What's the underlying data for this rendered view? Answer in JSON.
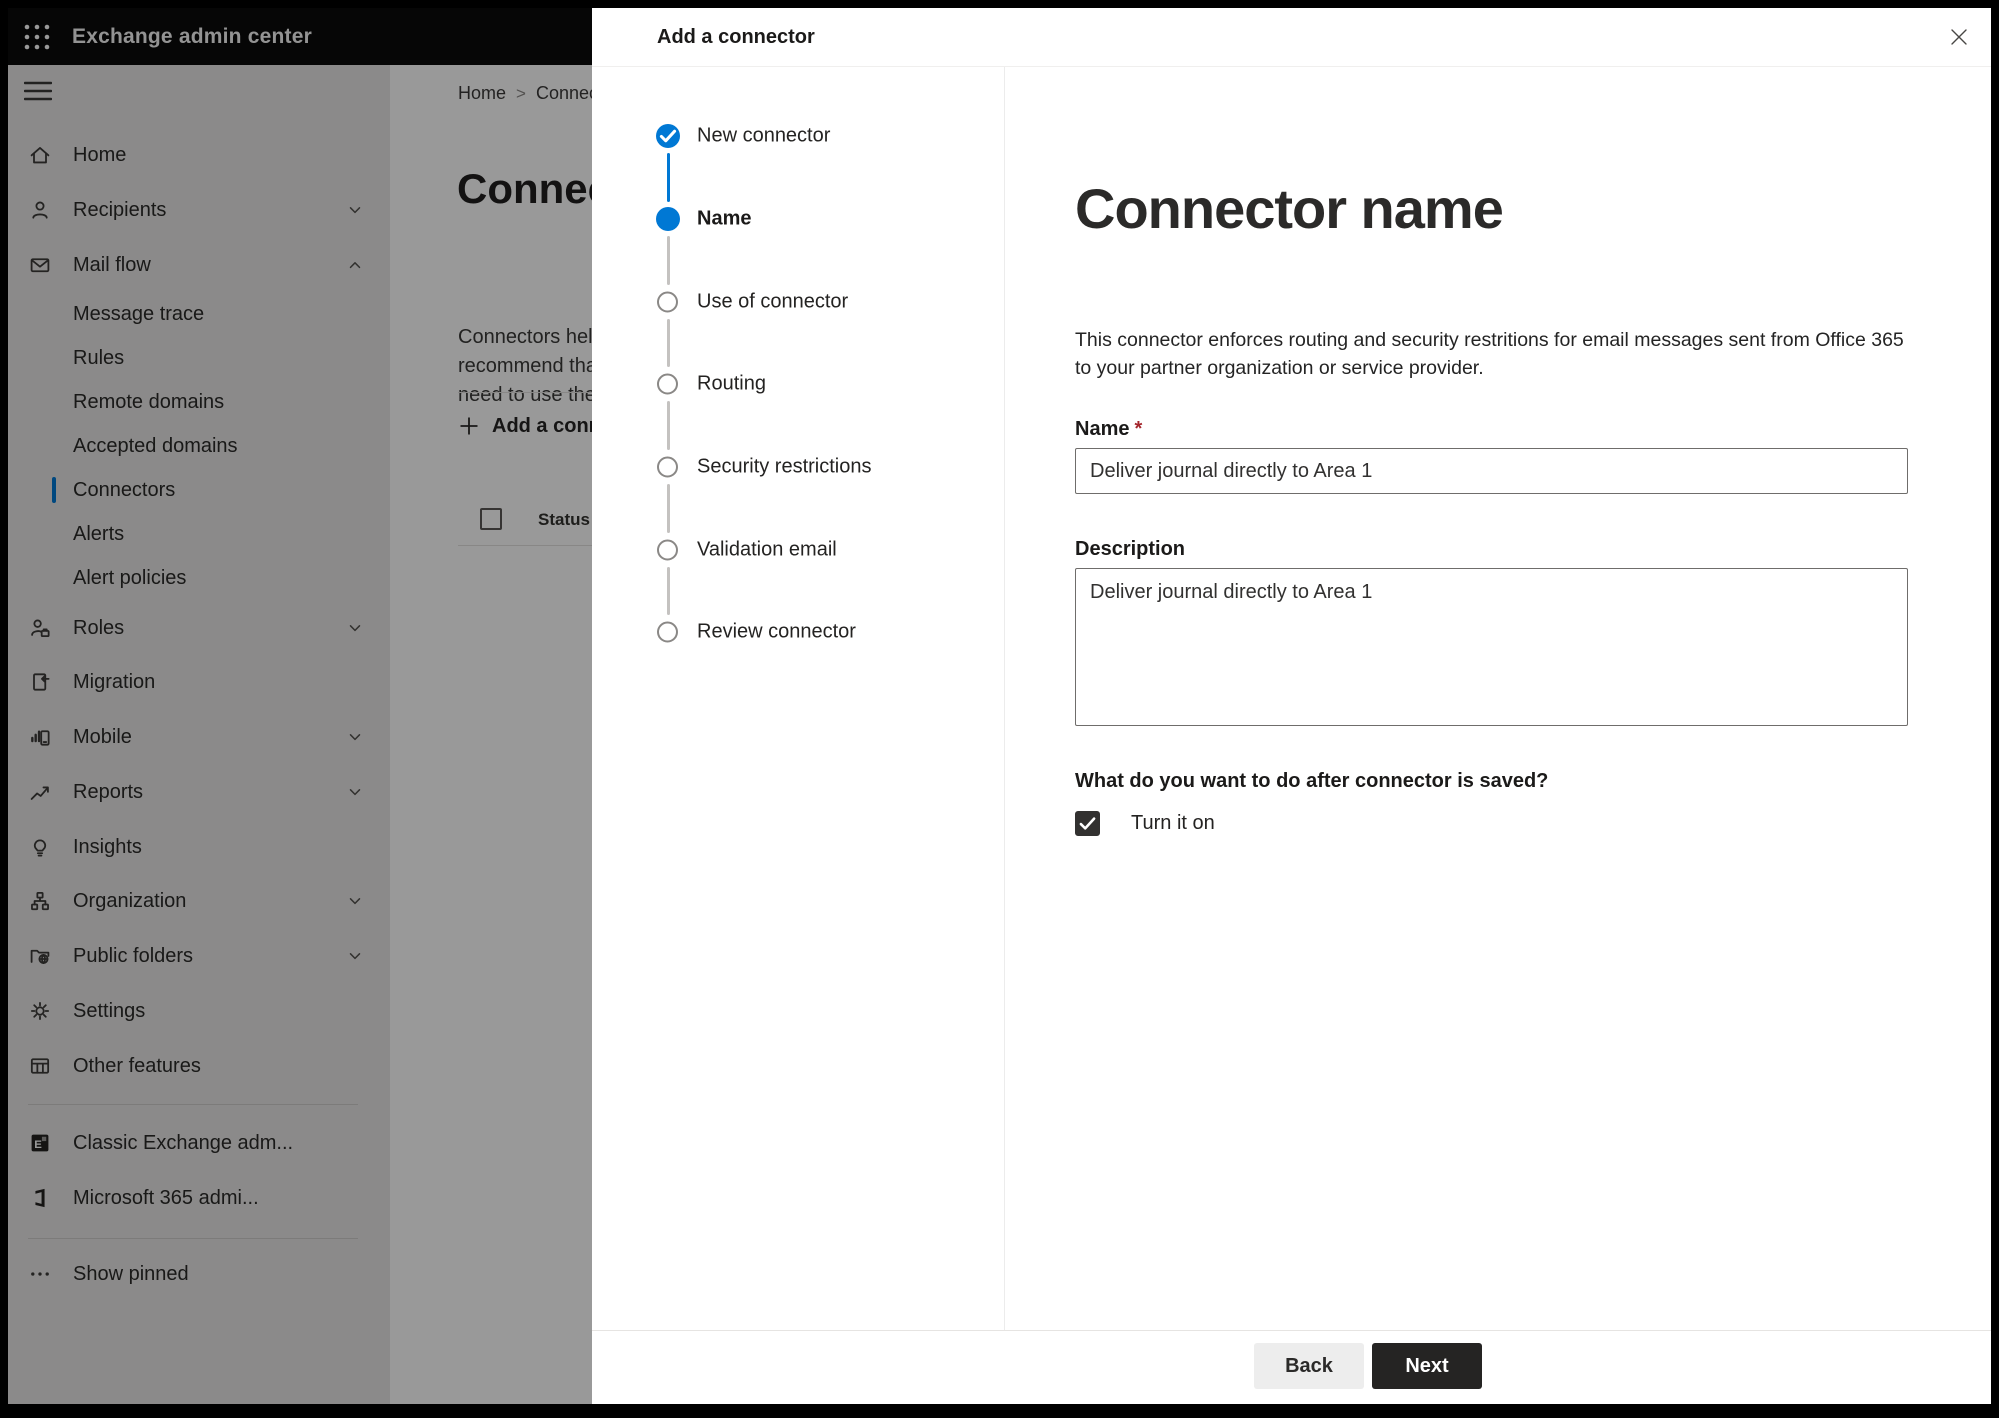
{
  "topbar": {
    "app_title": "Exchange admin center"
  },
  "breadcrumb": {
    "home": "Home",
    "separator": ">",
    "current": "Connectors"
  },
  "background_page": {
    "title": "Connect",
    "intro_lines": [
      "Connectors help",
      "recommend that",
      "need to use ther"
    ],
    "add_button_label": "Add a connector",
    "table": {
      "status_header": "Status"
    }
  },
  "sidebar": {
    "items": [
      {
        "label": "Home",
        "icon": "home-icon"
      },
      {
        "label": "Recipients",
        "icon": "person-icon",
        "chevron": "down"
      },
      {
        "label": "Mail flow",
        "icon": "mail-icon",
        "chevron": "up",
        "expanded": true
      },
      {
        "label": "Message trace",
        "child": true
      },
      {
        "label": "Rules",
        "child": true
      },
      {
        "label": "Remote domains",
        "child": true
      },
      {
        "label": "Accepted domains",
        "child": true
      },
      {
        "label": "Connectors",
        "child": true,
        "selected": true
      },
      {
        "label": "Alerts",
        "child": true
      },
      {
        "label": "Alert policies",
        "child": true
      },
      {
        "label": "Roles",
        "icon": "roles-icon",
        "chevron": "down"
      },
      {
        "label": "Migration",
        "icon": "migration-icon"
      },
      {
        "label": "Mobile",
        "icon": "mobile-icon",
        "chevron": "down"
      },
      {
        "label": "Reports",
        "icon": "reports-icon",
        "chevron": "down"
      },
      {
        "label": "Insights",
        "icon": "insights-icon"
      },
      {
        "label": "Organization",
        "icon": "organization-icon",
        "chevron": "down"
      },
      {
        "label": "Public folders",
        "icon": "public-folders-icon",
        "chevron": "down"
      },
      {
        "label": "Settings",
        "icon": "settings-icon"
      },
      {
        "label": "Other features",
        "icon": "other-features-icon"
      },
      {
        "divider": true
      },
      {
        "label": "Classic Exchange adm...",
        "icon": "classic-exchange-icon"
      },
      {
        "label": "Microsoft 365 admi...",
        "icon": "microsoft-365-icon"
      },
      {
        "divider": true
      },
      {
        "label": "Show pinned",
        "icon": "ellipsis-icon"
      }
    ]
  },
  "modal": {
    "title": "Add a connector",
    "close_icon": "close-icon",
    "steps": [
      {
        "label": "New connector",
        "state": "completed"
      },
      {
        "label": "Name",
        "state": "current"
      },
      {
        "label": "Use of connector",
        "state": "upcoming"
      },
      {
        "label": "Routing",
        "state": "upcoming"
      },
      {
        "label": "Security restrictions",
        "state": "upcoming"
      },
      {
        "label": "Validation email",
        "state": "upcoming"
      },
      {
        "label": "Review connector",
        "state": "upcoming"
      }
    ],
    "content": {
      "heading": "Connector name",
      "description_lines": [
        "This connector enforces routing and security restritions for email messages sent from Office 365",
        "to your partner organization or service provider."
      ],
      "name_label": "Name",
      "required_marker": "*",
      "name_value": "Deliver journal directly to Area 1",
      "description_label": "Description",
      "description_value": "Deliver journal directly to Area 1",
      "after_save_question": "What do you want to do after connector is saved?",
      "turn_on_label": "Turn it on",
      "turn_on_checked": true
    },
    "footer": {
      "back_label": "Back",
      "next_label": "Next"
    }
  },
  "colors": {
    "accent": "#0078d4",
    "topbar_bg": "#0a0a0a",
    "required_marker": "#a4262c",
    "next_button_bg": "#252423",
    "back_button_bg": "#ededed",
    "step_inactive_border": "#8a8886",
    "step_line_gray": "#c4c2c0"
  }
}
